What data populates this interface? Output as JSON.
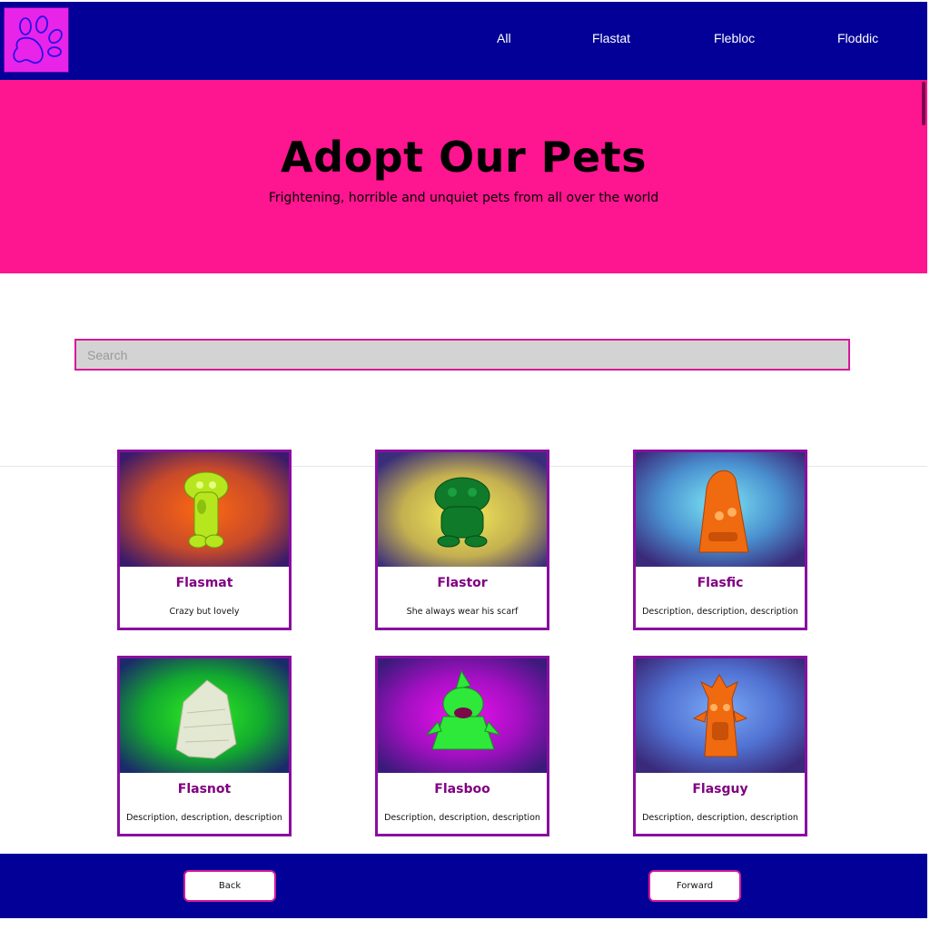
{
  "nav": {
    "logo_icon": "paw-icon",
    "items": [
      "All",
      "Flastat",
      "Flebloc",
      "Floddic"
    ]
  },
  "hero": {
    "title": "Adopt Our Pets",
    "subtitle": "Frightening, horrible and unquiet pets from all over the world"
  },
  "search": {
    "placeholder": "Search",
    "value": ""
  },
  "pets": [
    {
      "name": "Flasmat",
      "description": "Crazy but lovely"
    },
    {
      "name": "Flastor",
      "description": "She always wear his scarf"
    },
    {
      "name": "Flasfic",
      "description": "Description, description, description"
    },
    {
      "name": "Flasnot",
      "description": "Description, description, description"
    },
    {
      "name": "Flasboo",
      "description": "Description, description, description"
    },
    {
      "name": "Flasguy",
      "description": "Description, description, description"
    }
  ],
  "footer": {
    "back_label": "Back",
    "forward_label": "Forward"
  },
  "colors": {
    "nav_bg": "#020096",
    "hero_bg": "#fe1590",
    "accent": "#d6199a",
    "card_border": "#8a0ea0",
    "card_title": "#800080"
  }
}
